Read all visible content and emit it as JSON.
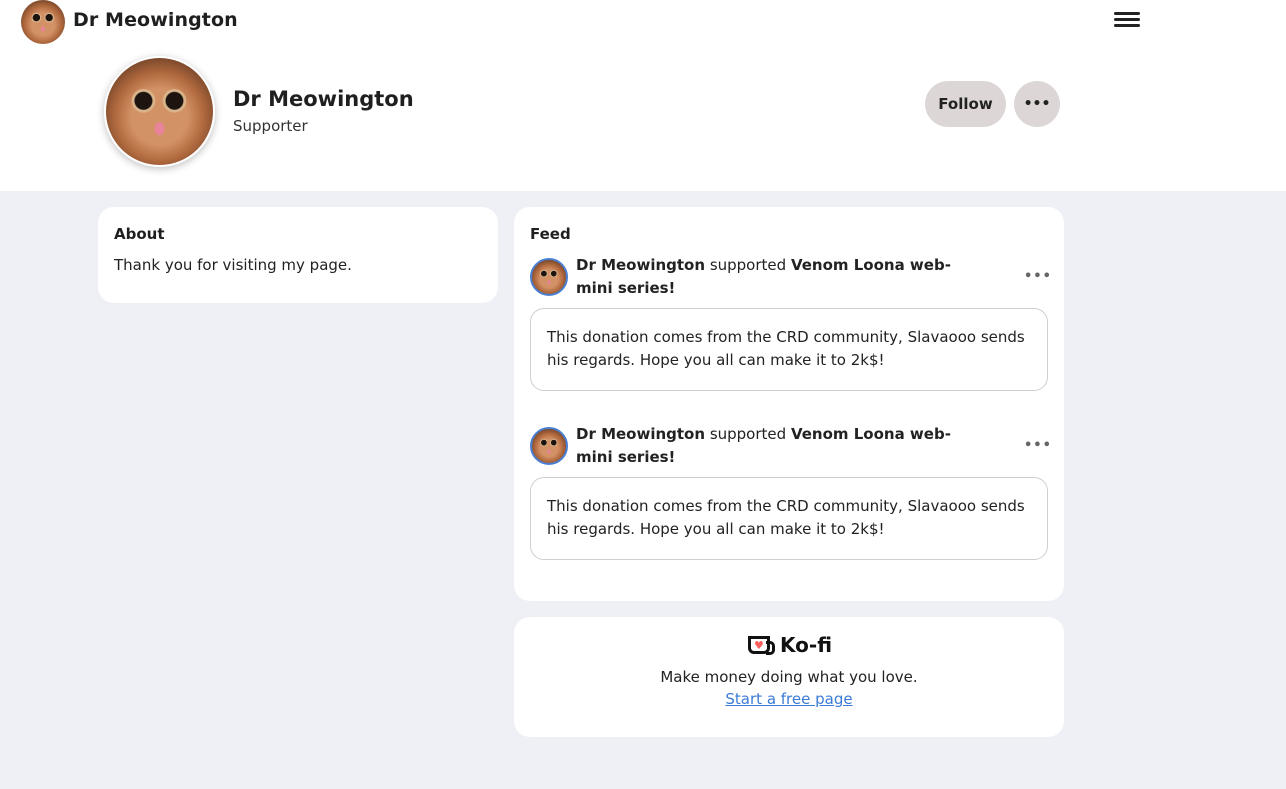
{
  "nav": {
    "name": "Dr Meowington"
  },
  "profile": {
    "name": "Dr Meowington",
    "role": "Supporter",
    "follow_label": "Follow",
    "more_label": "•••"
  },
  "about": {
    "title": "About",
    "text": "Thank you for visiting my page."
  },
  "feed": {
    "title": "Feed",
    "posts": [
      {
        "user": "Dr Meowington",
        "action": " supported ",
        "target": "Venom Loona web-mini series!",
        "more": "•••",
        "body": "This donation comes from the CRD community, Slavaooo sends his regards. Hope you all can make it to 2k$!"
      },
      {
        "user": "Dr Meowington",
        "action": " supported ",
        "target": "Venom Loona web-mini series!",
        "more": "•••",
        "body": "This donation comes from the CRD community, Slavaooo sends his regards. Hope you all can make it to 2k$!"
      }
    ]
  },
  "kofi": {
    "brand": "Ko-fi",
    "tagline": "Make money doing what you love.",
    "link": "Start a free page"
  },
  "colors": {
    "accent_link": "#3b7bd6",
    "page_bg": "#eef0f5",
    "button_bg": "#ddd6d6",
    "kofi_heart": "#ff5e5b"
  }
}
